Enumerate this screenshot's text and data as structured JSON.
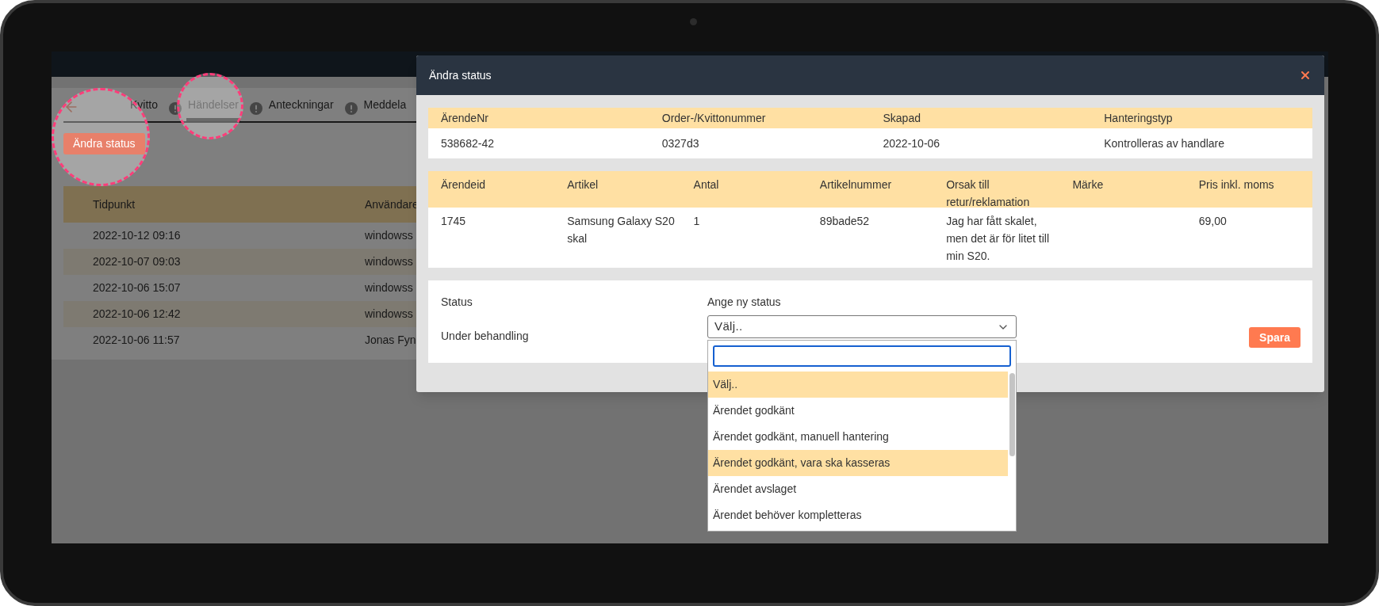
{
  "background_app": {
    "tabs": [
      {
        "label": "Kvitto",
        "selected": false,
        "alert": false
      },
      {
        "label": "Händelser",
        "selected": true,
        "alert": true
      },
      {
        "label": "Anteckningar",
        "selected": false,
        "alert": true
      },
      {
        "label": "Meddela",
        "selected": false,
        "alert": true
      }
    ],
    "action_button": "Ändra status",
    "events_table": {
      "columns": [
        "Tidpunkt",
        "Användare"
      ],
      "rows": [
        {
          "cells": [
            "2022-10-12 09:16",
            "windowss"
          ]
        },
        {
          "cells": [
            "2022-10-07 09:03",
            "windowss"
          ]
        },
        {
          "cells": [
            "2022-10-06 15:07",
            "windowss"
          ]
        },
        {
          "cells": [
            "2022-10-06 12:42",
            "windowss"
          ]
        },
        {
          "cells": [
            "2022-10-06 11:57",
            "Jonas Fyn"
          ]
        }
      ]
    }
  },
  "modal": {
    "title": "Ändra status",
    "case_table": {
      "columns": [
        "ÄrendeNr",
        "Order-/Kvittonummer",
        "Skapad",
        "Hanteringstyp"
      ],
      "rows": [
        {
          "cells": [
            "538682-42",
            "0327d3",
            "2022-10-06",
            "Kontrolleras av handlare"
          ]
        }
      ]
    },
    "item_table": {
      "columns": [
        "Ärendeid",
        "Artikel",
        "Antal",
        "Artikelnummer",
        "Orsak till retur/reklamation",
        "Märke",
        "Pris inkl. moms"
      ],
      "rows": [
        {
          "cells": [
            "1745",
            "Samsung Galaxy S20 skal",
            "1",
            "89bade52",
            "Jag har fått skalet, men det är för litet till min S20.",
            "",
            "69,00"
          ]
        }
      ]
    },
    "status": {
      "label": "Status",
      "value": "Under behandling"
    },
    "new_status": {
      "label": "Ange ny status",
      "value": "Välj..",
      "options": [
        {
          "label": "Välj..",
          "highlighted": true
        },
        {
          "label": "Ärendet godkänt",
          "highlighted": false
        },
        {
          "label": "Ärendet godkänt, manuell hantering",
          "highlighted": false
        },
        {
          "label": "Ärendet godkänt, vara ska kasseras",
          "highlighted": true
        },
        {
          "label": "Ärendet avslaget",
          "highlighted": false
        },
        {
          "label": "Ärendet behöver kompletteras",
          "highlighted": false
        }
      ]
    },
    "save_button": "Spara"
  }
}
